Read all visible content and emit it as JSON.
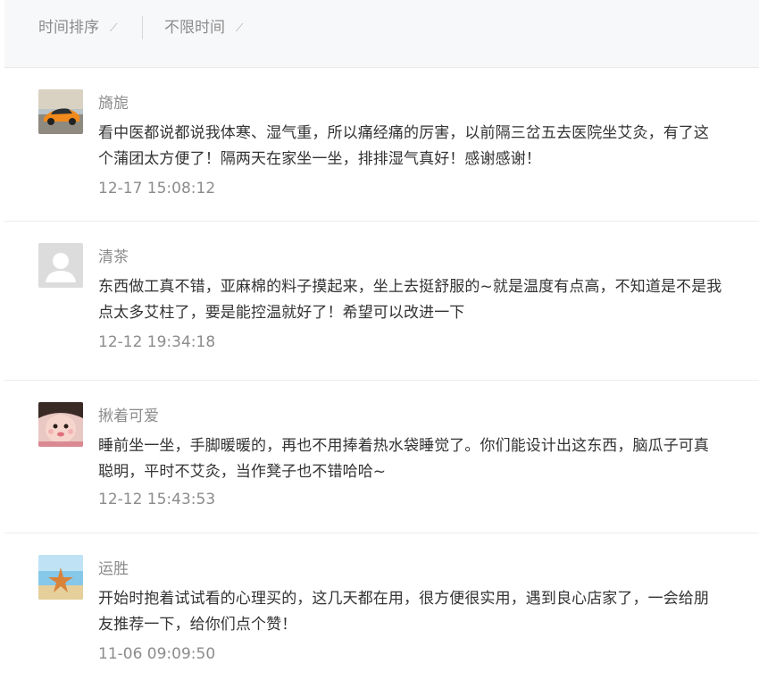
{
  "filters": {
    "sort_label": "时间排序",
    "time_label": "不限时间",
    "caret_icon": "pencil-caret-icon"
  },
  "reviews": [
    {
      "name": "旖旎",
      "text": "看中医都说都说我体寒、湿气重，所以痛经痛的厉害，以前隔三岔五去医院坐艾灸，有了这个蒲团太方便了！隔两天在家坐一坐，排排湿气真好！感谢感谢！",
      "time": "12-17 15:08:12",
      "avatar": "car-photo-avatar"
    },
    {
      "name": "清茶",
      "text": "东西做工真不错，亚麻棉的料子摸起来，坐上去挺舒服的~就是温度有点高，不知道是不是我点太多艾柱了，要是能控温就好了！希望可以改进一下",
      "time": "12-12 19:34:18",
      "avatar": "default-user-avatar"
    },
    {
      "name": "揪着可爱",
      "text": "睡前坐一坐，手脚暖暖的，再也不用捧着热水袋睡觉了。你们能设计出这东西，脑瓜子可真聪明，平时不艾灸，当作凳子也不错哈哈~",
      "time": "12-12 15:43:53",
      "avatar": "child-face-avatar"
    },
    {
      "name": "运胜",
      "text": "开始时抱着试试看的心理买的，这几天都在用，很方便很实用，遇到良心店家了，一会给朋友推荐一下，给你们点个赞！",
      "time": "11-06 09:09:50",
      "avatar": "starfish-beach-avatar"
    }
  ]
}
